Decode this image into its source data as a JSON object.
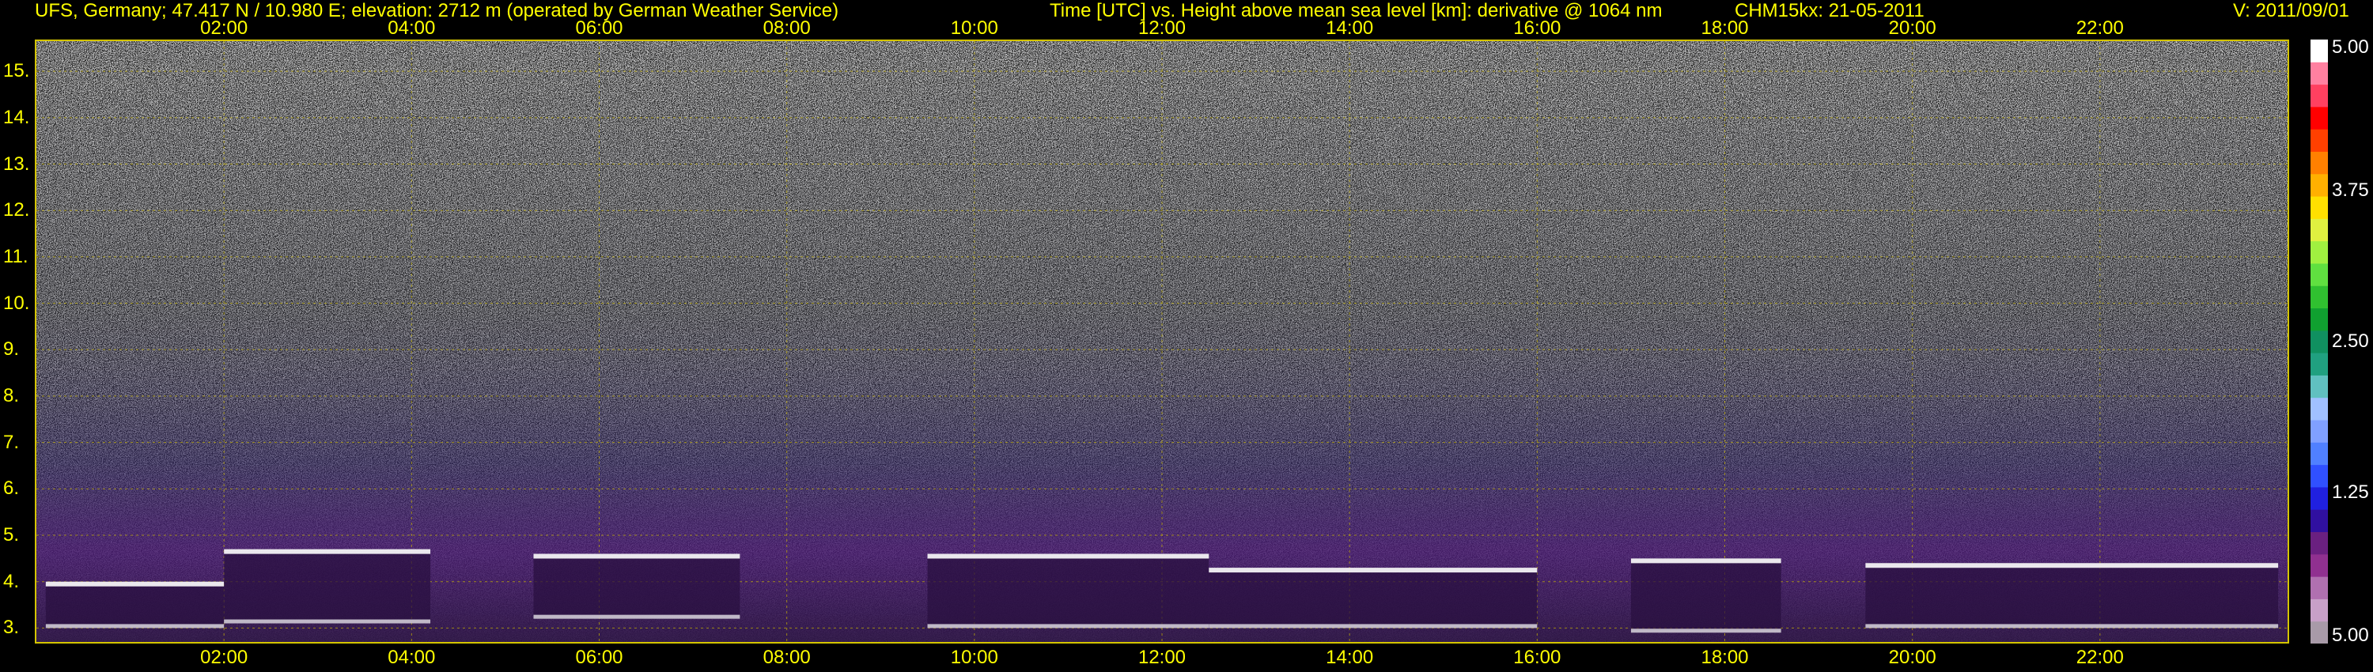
{
  "header": {
    "station": "UFS, Germany; 47.417 N / 10.980 E; elevation: 2712 m  (operated by German Weather Service)",
    "axes_desc": "Time [UTC] vs. Height above mean sea level [km]: derivative @ 1064 nm",
    "instrument": "CHM15kx: 21-05-2011",
    "version": "V: 2011/09/01"
  },
  "colors": {
    "label": "#ffff00",
    "frame": "#d4c400",
    "grid": "#c8b400",
    "background": "#000000"
  },
  "chart_data": {
    "type": "heatmap",
    "title": "Time [UTC] vs. Height above mean sea level [km]: derivative @ 1064 nm",
    "xlabel": "Time [UTC]",
    "ylabel": "Height above mean sea level [km]",
    "x_ticks": [
      "02:00",
      "04:00",
      "06:00",
      "08:00",
      "10:00",
      "12:00",
      "14:00",
      "16:00",
      "18:00",
      "20:00",
      "22:00"
    ],
    "x_tick_hours": [
      2,
      4,
      6,
      8,
      10,
      12,
      14,
      16,
      18,
      20,
      22
    ],
    "xlim": [
      0,
      24
    ],
    "y_ticks": [
      "3.",
      "4.",
      "5.",
      "6.",
      "7.",
      "8.",
      "9.",
      "10.",
      "11.",
      "12.",
      "13.",
      "14.",
      "15."
    ],
    "y_tick_values": [
      3,
      4,
      5,
      6,
      7,
      8,
      9,
      10,
      11,
      12,
      13,
      14,
      15
    ],
    "ylim": [
      2.7,
      15.65
    ],
    "grid": true,
    "colorbar": {
      "labels": [
        "5.00",
        "3.75",
        "2.50",
        "1.25",
        "5.00"
      ],
      "label_positions": [
        5.0,
        3.75,
        2.5,
        1.25,
        0.0
      ],
      "range": [
        0,
        5
      ],
      "colors": [
        "#a89aa8",
        "#c8a0c8",
        "#b070b0",
        "#903090",
        "#6a2080",
        "#3010a0",
        "#2020e0",
        "#3050ff",
        "#5080ff",
        "#80a0ff",
        "#a0c0ff",
        "#60c0c0",
        "#20a080",
        "#109060",
        "#10a030",
        "#30c030",
        "#60e040",
        "#a0f040",
        "#e0f040",
        "#ffe000",
        "#ffb000",
        "#ff8000",
        "#ff4000",
        "#ff0000",
        "#ff4060",
        "#ff80a0",
        "#ffffff"
      ]
    },
    "cloud_layers": [
      {
        "start": 0.1,
        "end": 2.0,
        "bottom": 3.0,
        "top": 4.0
      },
      {
        "start": 2.0,
        "end": 4.2,
        "bottom": 3.1,
        "top": 4.7
      },
      {
        "start": 5.3,
        "end": 7.5,
        "bottom": 3.2,
        "top": 4.6
      },
      {
        "start": 9.5,
        "end": 12.5,
        "bottom": 3.0,
        "top": 4.6
      },
      {
        "start": 12.5,
        "end": 16.0,
        "bottom": 3.0,
        "top": 4.3
      },
      {
        "start": 17.0,
        "end": 18.6,
        "bottom": 2.9,
        "top": 4.5
      },
      {
        "start": 19.5,
        "end": 23.9,
        "bottom": 3.0,
        "top": 4.4
      }
    ]
  }
}
